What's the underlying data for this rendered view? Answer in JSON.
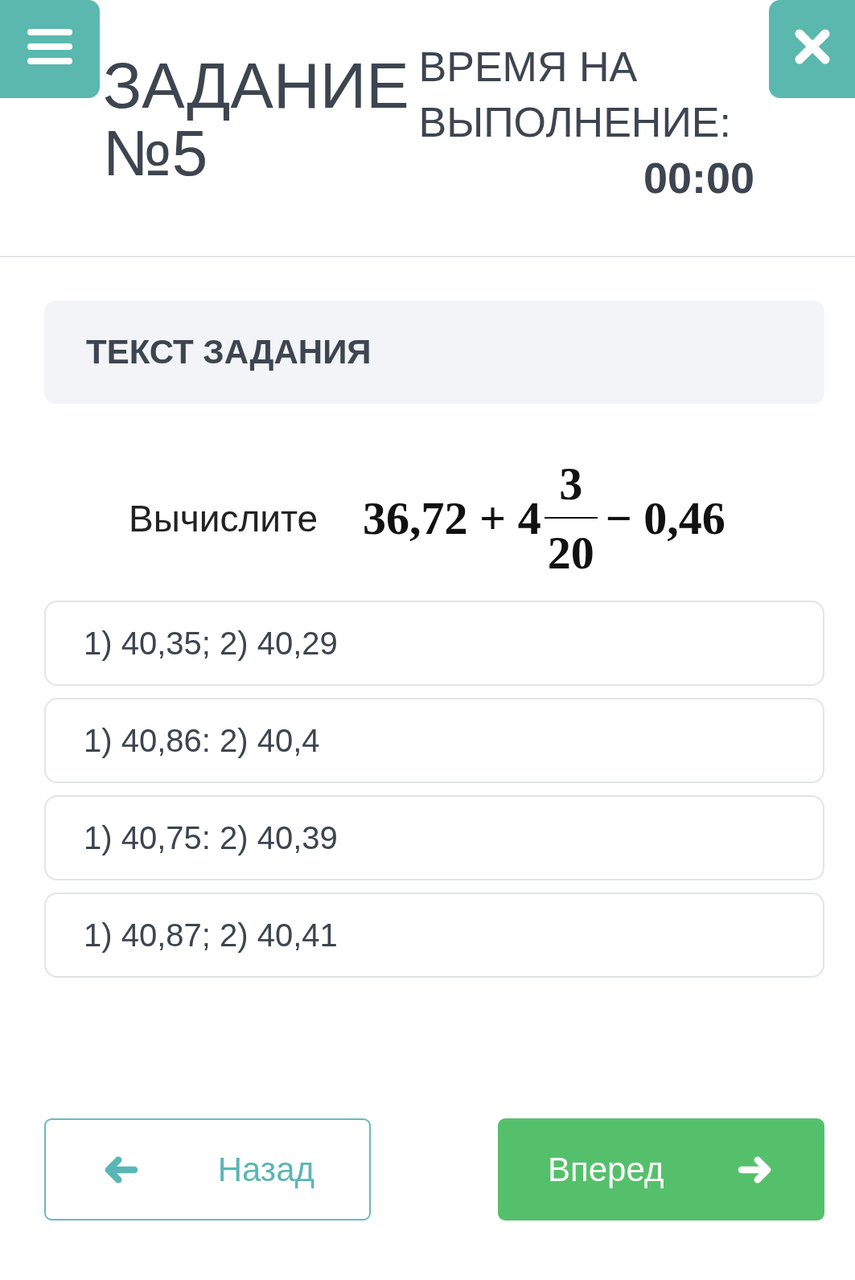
{
  "header": {
    "title": "ЗАДАНИЕ №5",
    "timer": {
      "label": "ВРЕМЯ НА ВЫПОЛНЕНИЕ:",
      "value": "00:00"
    }
  },
  "task": {
    "heading": "ТЕКСТ ЗАДАНИЯ",
    "prompt": "Вычислите",
    "expression": [
      {
        "kind": "text",
        "text": "36,72 + 4"
      },
      {
        "kind": "fraction",
        "numerator": "3",
        "denominator": "20"
      },
      {
        "kind": "text",
        "text": "− 0,46"
      }
    ]
  },
  "options": [
    {
      "text": "1) 40,35; 2) 40,29",
      "selected": false
    },
    {
      "text": "1) 40,86: 2) 40,4",
      "selected": false
    },
    {
      "text": "1) 40,75: 2) 40,39",
      "selected": false
    },
    {
      "text": "1) 40,87; 2) 40,41",
      "selected": false
    }
  ],
  "navigation": [
    {
      "kind": "back",
      "label": "Назад"
    },
    {
      "kind": "forward",
      "label": "Вперед"
    }
  ]
}
